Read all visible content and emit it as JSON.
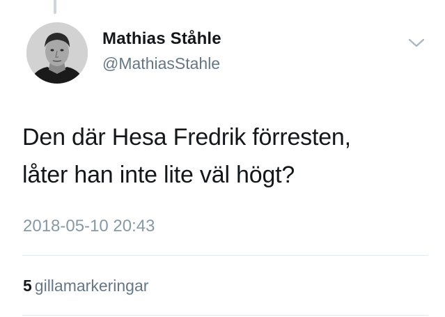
{
  "author": {
    "display_name": "Mathias Ståhle",
    "handle": "@MathiasStahle"
  },
  "tweet": {
    "text_lines": [
      "Den där Hesa Fredrik förresten,",
      "låter han inte lite väl högt?"
    ],
    "timestamp": "2018-05-10 20:43"
  },
  "stats": {
    "likes_count": "5",
    "likes_label": "gillamarkeringar"
  },
  "icons": {
    "menu": "chevron-down-icon"
  },
  "colors": {
    "text_primary": "#14171a",
    "text_secondary": "#657786",
    "timestamp": "#8899a6",
    "divider": "#e1e8ed",
    "thread_line": "#ccd6dd"
  }
}
